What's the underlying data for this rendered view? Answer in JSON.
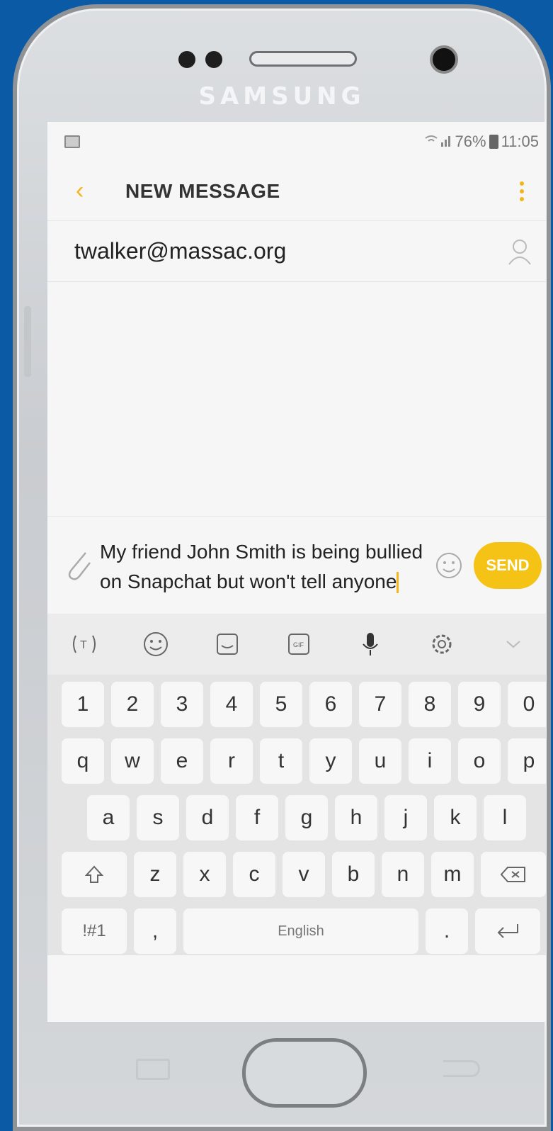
{
  "hardware": {
    "brand": "SAMSUNG"
  },
  "statusbar": {
    "signal_battery": "76%",
    "time": "11:05"
  },
  "appbar": {
    "title": "NEW MESSAGE"
  },
  "recipient": {
    "value": "twalker@massac.org"
  },
  "composer": {
    "message": "My friend John Smith is being bullied on Snapchat but won't tell anyone",
    "send_label": "SEND"
  },
  "keyboard": {
    "numbers": [
      "1",
      "2",
      "3",
      "4",
      "5",
      "6",
      "7",
      "8",
      "9",
      "0"
    ],
    "row1": [
      "q",
      "w",
      "e",
      "r",
      "t",
      "y",
      "u",
      "i",
      "o",
      "p"
    ],
    "row2": [
      "a",
      "s",
      "d",
      "f",
      "g",
      "h",
      "j",
      "k",
      "l"
    ],
    "row3": [
      "z",
      "x",
      "c",
      "v",
      "b",
      "n",
      "m"
    ],
    "sym_label": "!#1",
    "comma": ",",
    "space_label": "English",
    "period": "."
  },
  "colors": {
    "accent": "#f2b51c",
    "send": "#f5c316",
    "background": "#0a5aa6"
  }
}
